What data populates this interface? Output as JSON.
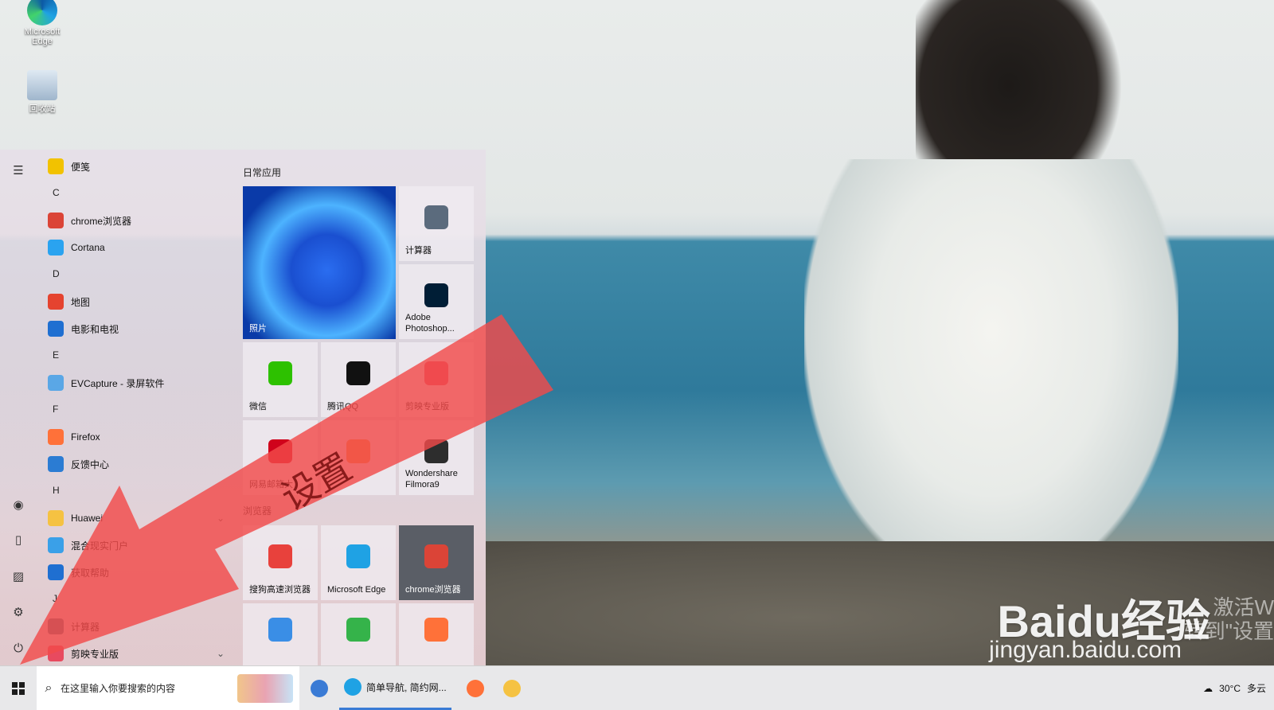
{
  "desktop": {
    "icons": [
      {
        "label": "Microsoft Edge",
        "icon": "edge-icon"
      },
      {
        "label": "回收站",
        "icon": "recycle-bin-icon"
      }
    ]
  },
  "start_menu": {
    "rail_icons": [
      "menu-icon",
      "user-icon",
      "document-icon",
      "pictures-icon",
      "settings-icon",
      "power-icon"
    ],
    "apps": [
      {
        "type": "app",
        "label": "便笺",
        "icon": "sticky-notes-icon",
        "color": "#f2c200"
      },
      {
        "type": "letter",
        "label": "C"
      },
      {
        "type": "app",
        "label": "chrome浏览器",
        "icon": "chrome-icon",
        "color": "#db4437"
      },
      {
        "type": "app",
        "label": "Cortana",
        "icon": "cortana-icon",
        "color": "#2aa3f0"
      },
      {
        "type": "letter",
        "label": "D"
      },
      {
        "type": "app",
        "label": "地图",
        "icon": "maps-icon",
        "color": "#e5432f"
      },
      {
        "type": "app",
        "label": "电影和电视",
        "icon": "movies-tv-icon",
        "color": "#1f6fd1"
      },
      {
        "type": "letter",
        "label": "E"
      },
      {
        "type": "app",
        "label": "EVCapture - 录屏软件",
        "icon": "evcapture-icon",
        "color": "#5aa7e6"
      },
      {
        "type": "letter",
        "label": "F"
      },
      {
        "type": "app",
        "label": "Firefox",
        "icon": "firefox-icon",
        "color": "#ff7139"
      },
      {
        "type": "app",
        "label": "反馈中心",
        "icon": "feedback-icon",
        "color": "#2b7cd3"
      },
      {
        "type": "letter",
        "label": "H"
      },
      {
        "type": "app",
        "label": "Huawei",
        "icon": "folder-icon",
        "color": "#f5c242",
        "expandable": true
      },
      {
        "type": "app",
        "label": "混合现实门户",
        "icon": "mixed-reality-icon",
        "color": "#3aa0e8"
      },
      {
        "type": "app",
        "label": "获取帮助",
        "icon": "help-icon",
        "color": "#1f6fd1"
      },
      {
        "type": "letter",
        "label": "J"
      },
      {
        "type": "app",
        "label": "计算器",
        "icon": "calculator-icon",
        "color": "#5b6b7d"
      },
      {
        "type": "app",
        "label": "剪映专业版",
        "icon": "capcut-icon",
        "color": "#e84a5f",
        "expandable": true
      }
    ],
    "tile_group_1": "日常应用",
    "tile_group_2": "浏览器",
    "tiles": [
      {
        "label": "照片",
        "kind": "photo"
      },
      {
        "label": "计算器",
        "kind": "normal",
        "icon": "calculator-icon",
        "color": "#5b6b7d"
      },
      {
        "label": "Adobe Photoshop...",
        "kind": "normal",
        "icon": "photoshop-icon",
        "color": "#001e36"
      },
      {
        "label": "微信",
        "kind": "normal",
        "icon": "wechat-icon",
        "color": "#2dc100"
      },
      {
        "label": "腾讯QQ",
        "kind": "normal",
        "icon": "qq-icon",
        "color": "#111111"
      },
      {
        "label": "剪映专业版",
        "kind": "normal",
        "icon": "capcut-icon",
        "color": "#e84a5f"
      },
      {
        "label": "网易邮箱大",
        "kind": "normal",
        "icon": "netease-mail-icon",
        "color": "#d0021b"
      },
      {
        "label": "",
        "kind": "normal",
        "icon": "app-icon",
        "color": "#f08a3a"
      },
      {
        "label": "Wondershare Filmora9",
        "kind": "normal",
        "icon": "filmora-icon",
        "color": "#2d2d2d"
      },
      {
        "label": "搜狗高速浏览器",
        "kind": "normal",
        "icon": "sogou-browser-icon",
        "color": "#e8413c"
      },
      {
        "label": "Microsoft Edge",
        "kind": "normal",
        "icon": "edge-icon",
        "color": "#1fa2e4"
      },
      {
        "label": "chrome浏览器",
        "kind": "chrome",
        "icon": "chrome-icon",
        "color": "#db4437"
      },
      {
        "label": "",
        "kind": "normal",
        "icon": "qq-browser-icon",
        "color": "#3a8ee6"
      },
      {
        "label": "",
        "kind": "normal",
        "icon": "360-browser-icon",
        "color": "#35b34a"
      },
      {
        "label": "",
        "kind": "normal",
        "icon": "firefox-icon",
        "color": "#ff7139"
      }
    ]
  },
  "annotation": {
    "label": "设置",
    "color": "#f24a4a"
  },
  "watermark": {
    "brand": "Baidu经验",
    "url": "jingyan.baidu.com",
    "activate_1": "激活W",
    "activate_2": "转到\"设置"
  },
  "taskbar": {
    "search_placeholder": "在这里输入你要搜索的内容",
    "items": [
      {
        "label": "",
        "icon": "sogou-browser-icon",
        "color": "#3a7bd5"
      },
      {
        "label": "简单导航, 简约网...",
        "icon": "edge-icon",
        "color": "#1fa2e4",
        "active": true
      },
      {
        "label": "",
        "icon": "firefox-icon",
        "color": "#ff7139"
      },
      {
        "label": "",
        "icon": "file-explorer-icon",
        "color": "#f5c242"
      }
    ],
    "weather": {
      "temp": "30°C",
      "condition": "多云"
    }
  }
}
